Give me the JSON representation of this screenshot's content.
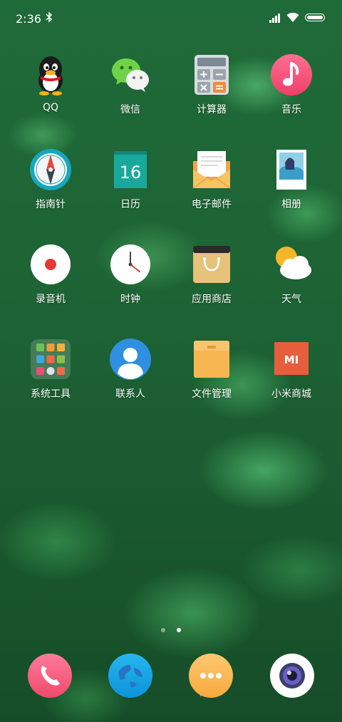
{
  "status_bar": {
    "time": "2:36",
    "bluetooth": "bluetooth-icon",
    "signal": "signal-icon",
    "wifi": "wifi-icon",
    "battery": "battery-icon"
  },
  "apps": [
    {
      "label": "QQ",
      "icon": "qq-penguin-icon"
    },
    {
      "label": "微信",
      "icon": "wechat-icon"
    },
    {
      "label": "计算器",
      "icon": "calculator-icon"
    },
    {
      "label": "音乐",
      "icon": "music-icon"
    },
    {
      "label": "指南针",
      "icon": "compass-icon"
    },
    {
      "label": "日历",
      "icon": "calendar-icon",
      "value": "16"
    },
    {
      "label": "电子邮件",
      "icon": "email-icon"
    },
    {
      "label": "相册",
      "icon": "gallery-icon"
    },
    {
      "label": "录音机",
      "icon": "recorder-icon"
    },
    {
      "label": "时钟",
      "icon": "clock-icon"
    },
    {
      "label": "应用商店",
      "icon": "app-store-icon"
    },
    {
      "label": "天气",
      "icon": "weather-icon"
    },
    {
      "label": "系统工具",
      "icon": "system-tools-folder-icon"
    },
    {
      "label": "联系人",
      "icon": "contacts-icon"
    },
    {
      "label": "文件管理",
      "icon": "file-manager-icon"
    },
    {
      "label": "小米商城",
      "icon": "mi-store-icon",
      "value": "MI"
    }
  ],
  "page_indicator": {
    "pages": 2,
    "current": 2
  },
  "dock": [
    {
      "icon": "phone-icon"
    },
    {
      "icon": "browser-globe-icon"
    },
    {
      "icon": "messages-icon"
    },
    {
      "icon": "camera-icon"
    }
  ]
}
